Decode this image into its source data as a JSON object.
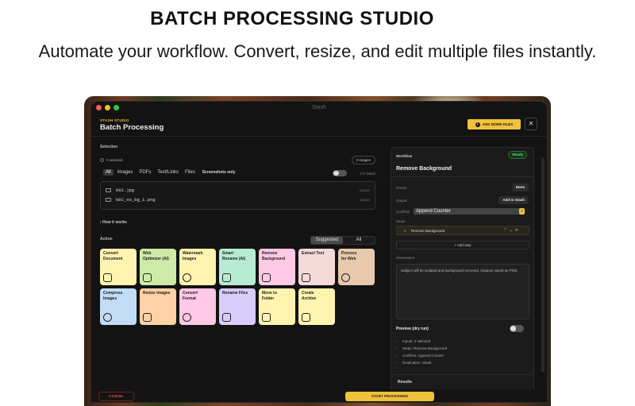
{
  "hero": {
    "title": "BATCH PROCESSING STUDIO",
    "subtitle": "Automate your workflow. Convert, resize, and edit multiple files instantly."
  },
  "window": {
    "title": "Stash"
  },
  "header": {
    "brand_small": "STASH STUDIO",
    "brand_big": "Batch Processing",
    "add_files_label": "ADD MORE FILES",
    "close_label": "✕"
  },
  "selection": {
    "label": "Selection",
    "count_label": "2 selected",
    "images_pill": "2 images",
    "filters": [
      "All",
      "Images",
      "PDFs",
      "Text/Links",
      "Files"
    ],
    "active_filter": "All",
    "screenshots_only_label": "Screenshots only",
    "in_batch_label": "2 in batch",
    "files": [
      {
        "name": "b02.jpg",
        "type": "IMAGE"
      },
      {
        "name": "b02_no_bg_1.png",
        "type": "IMAGE"
      }
    ],
    "how_it_works_label": "How it works"
  },
  "action": {
    "label": "Action",
    "segments": [
      "Suggested",
      "All"
    ],
    "active_segment": "Suggested",
    "tiles": [
      {
        "label": "Convert\nDocument",
        "color": "#fff3b0",
        "icon": "document-icon"
      },
      {
        "label": "Web\nOptimizer (AI)",
        "color": "#cdeaa6",
        "icon": "magic-wand-icon"
      },
      {
        "label": "Watermark\nImages",
        "color": "#fff3b0",
        "icon": "badge-icon"
      },
      {
        "label": "Smart\nRename (AI)",
        "color": "#b7ecd3",
        "icon": "sparkle-icon"
      },
      {
        "label": "Remove\nBackground",
        "color": "#ffc8e4",
        "icon": "magic-wand-icon"
      },
      {
        "label": "Extract Text",
        "color": "#f5d9d9",
        "icon": "text-scan-icon"
      },
      {
        "label": "Process\nfor Web",
        "color": "#e8c9ae",
        "icon": "globe-icon"
      },
      {
        "label": "Compress\nImages",
        "color": "#c2dcf6",
        "icon": "download-circle-icon"
      },
      {
        "label": "Resize Images",
        "color": "#ffd1a6",
        "icon": "resize-icon"
      },
      {
        "label": "Convert\nFormat",
        "color": "#ffc8e4",
        "icon": "refresh-icon"
      },
      {
        "label": "Rename Files",
        "color": "#d8cdfa",
        "icon": "pencil-icon"
      },
      {
        "label": "Move to\nFolder",
        "color": "#fff3b0",
        "icon": "folder-icon"
      },
      {
        "label": "Create\nArchive",
        "color": "#fff3b0",
        "icon": "archive-icon"
      }
    ]
  },
  "workflow": {
    "label": "Workflow",
    "status": "Ready",
    "title": "Remove Background",
    "preset_label": "Preset",
    "preset_value": "None",
    "output_label": "Output",
    "output_value": "Add to Stash",
    "conflicts_label": "Conflicts",
    "conflicts_value": "Append Counter",
    "steps_label": "Steps",
    "steps": [
      {
        "num": "1",
        "name": "Remove Background"
      }
    ],
    "add_step_label": "+ Add step",
    "parameters_label": "Parameters",
    "parameters_text": "Subject will be isolated and background removed. Outputs saved as PNG.",
    "preview_label": "Preview (dry run)",
    "preview_items": [
      "Inputs: 2 selected",
      "Steps: Remove Background",
      "Conflicts: Append Counter",
      "Destination: Stash"
    ],
    "results_label": "Results"
  },
  "footer": {
    "cancel_label": "CANCEL",
    "start_label": "START PROCESSING"
  },
  "colors": {
    "accent": "#f0c13a",
    "window_bg": "#131313",
    "panel_bg": "#1b1b1b",
    "ready_green": "#74d47d",
    "cancel_red": "#d85050"
  }
}
